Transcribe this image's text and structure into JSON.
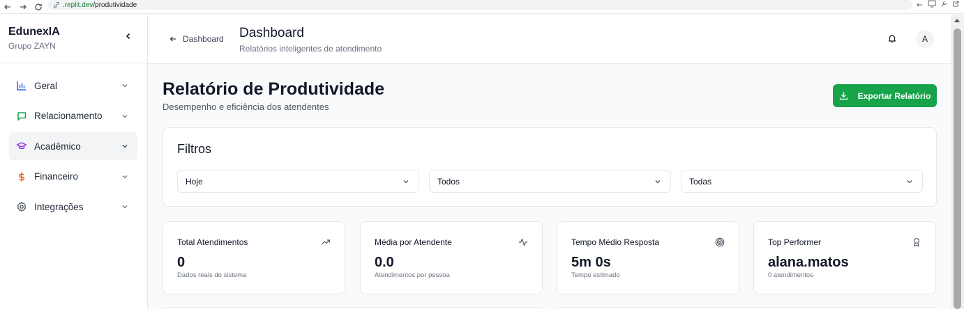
{
  "browser": {
    "url_host": ".replit.dev",
    "url_path": "/produtividade"
  },
  "sidebar": {
    "brand": "EdunexIA",
    "brand_sub": "Grupo ZAYN",
    "items": [
      {
        "label": "Geral",
        "icon": "bar-chart-icon",
        "color": "#2563eb"
      },
      {
        "label": "Relacionamento",
        "icon": "message-square-icon",
        "color": "#16a34a"
      },
      {
        "label": "Acadêmico",
        "icon": "graduation-cap-icon",
        "color": "#9333ea"
      },
      {
        "label": "Financeiro",
        "icon": "dollar-sign-icon",
        "color": "#ea580c"
      },
      {
        "label": "Integrações",
        "icon": "gear-icon",
        "color": "#4b5563"
      }
    ]
  },
  "header": {
    "back_label": "Dashboard",
    "title": "Dashboard",
    "subtitle": "Relatórios inteligentes de atendimento",
    "avatar": "A"
  },
  "main": {
    "title": "Relatório de Produtividade",
    "subtitle": "Desempenho e eficiência dos atendentes",
    "export_label": "Exportar Relatório",
    "accent": "#16a34a"
  },
  "filters": {
    "title": "Filtros",
    "period": "Hoje",
    "agent": "Todos",
    "channel": "Todas"
  },
  "stats": [
    {
      "label": "Total Atendimentos",
      "value": "0",
      "caption": "Dados reais do sistema",
      "icon": "trending-up-icon"
    },
    {
      "label": "Média por Atendente",
      "value": "0.0",
      "caption": "Atendimentos por pessoa",
      "icon": "activity-icon"
    },
    {
      "label": "Tempo Médio Resposta",
      "value": "5m 0s",
      "caption": "Tempo estimado",
      "icon": "target-icon"
    },
    {
      "label": "Top Performer",
      "value": "alana.matos",
      "caption": "0 atendimentos",
      "icon": "award-icon"
    }
  ]
}
